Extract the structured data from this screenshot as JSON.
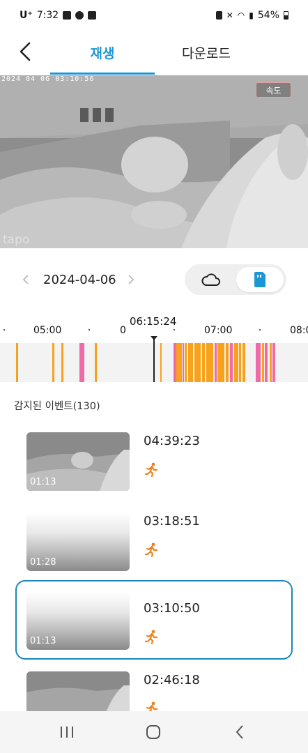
{
  "status_bar": {
    "carrier": "U⁺",
    "time": "7:32",
    "battery": "54%"
  },
  "header": {
    "tabs": [
      {
        "label": "재생",
        "active": true
      },
      {
        "label": "다운로드",
        "active": false
      }
    ]
  },
  "player": {
    "overlay_timestamp": "2024 04 06  03:10:56",
    "speed_label": "속도",
    "logo_text": "tapo"
  },
  "date_nav": {
    "date": "2024-04-06",
    "prev_icon": "chevron-left-icon",
    "next_icon": "chevron-right-icon",
    "storage_options": [
      "cloud-icon",
      "sd-card-icon"
    ],
    "storage_selected": "sd-card"
  },
  "timeline": {
    "current_time": "06:15:24",
    "tick_labels": [
      "05:00",
      "0",
      "07:00",
      "08:0"
    ],
    "colors": {
      "motion": "#f7a21b",
      "person": "#ef6aa7",
      "background": "#f3f3f3"
    }
  },
  "events": {
    "title": "감지된 이벤트(130)",
    "items": [
      {
        "time": "04:39:23",
        "duration": "01:13",
        "type": "motion",
        "selected": false
      },
      {
        "time": "03:18:51",
        "duration": "01:28",
        "type": "motion",
        "selected": false
      },
      {
        "time": "03:10:50",
        "duration": "01:13",
        "type": "motion",
        "selected": true
      },
      {
        "time": "02:46:18",
        "duration": "",
        "type": "motion",
        "selected": false
      }
    ]
  },
  "colors": {
    "accent": "#1c97d6",
    "event_icon": "#f0821e"
  }
}
